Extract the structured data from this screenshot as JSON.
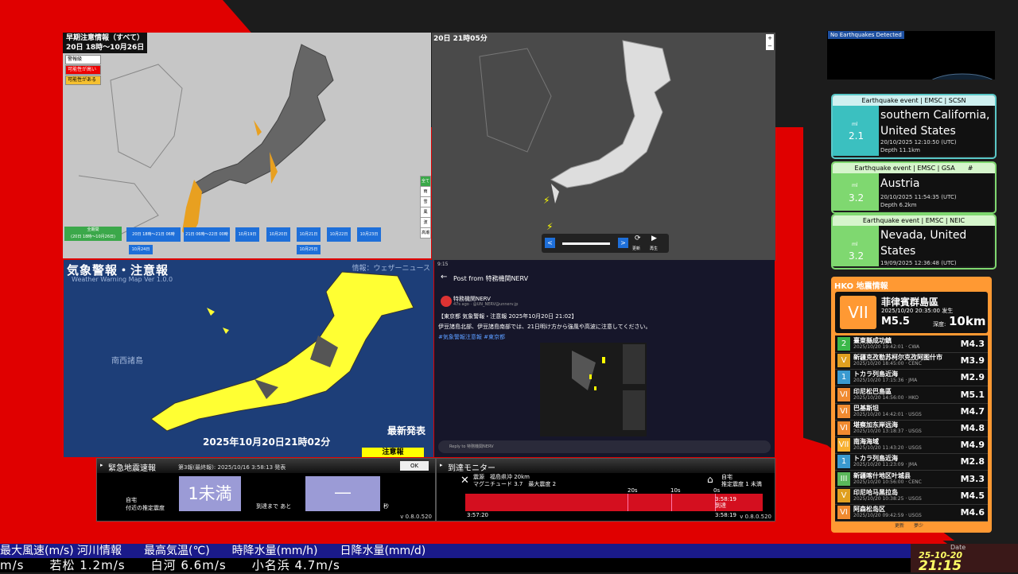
{
  "forecast": {
    "title": "早期注意情報（すべて）",
    "range": "20日 18時〜10月26日",
    "legend": [
      "警報級",
      "可能性が高い",
      "可能性がある"
    ],
    "buttons": [
      "全期間\n(20日 18時〜10月26日)",
      "20日 18時〜21日 06時",
      "21日 06時〜22日 00時",
      "10月19日",
      "10月20日",
      "10月21日",
      "10月22日",
      "10月23日",
      "10月24日",
      "10月25日"
    ],
    "side": [
      "全て",
      "雨",
      "雪",
      "風",
      "波",
      "高潮"
    ]
  },
  "map2": {
    "title": "20日 21時05分",
    "update": "更新",
    "play": "再生"
  },
  "warning": {
    "title": "気象警報・注意報",
    "subtitle": "Weather Warning Map Ver 1.0.0",
    "info": "情報：ウェザーニュース",
    "region": "南西諸島",
    "latest": "最新発表",
    "datetime": "2025年10月20日21時02分",
    "tag": "注意報"
  },
  "post": {
    "status_time": "9:15",
    "header": "Post from 特務機関NERV",
    "user": "特務機関NERV",
    "handle": "47s ago · @UN_NERV@unnerv.jp",
    "line1": "【東京都 気象警報・注意報 2025年10月20日 21:02】",
    "line2": "伊豆諸島北部、伊豆諸島南部では、21日明け方から強風や高波に注意してください。",
    "hashtags": "#気象警報注意報 #東京都",
    "reply": "Reply to 特務機関NERV"
  },
  "eew": {
    "title": "緊急地震速報",
    "sub": "第3報(最終報): 2025/10/16 3:58:13 発表",
    "ok": "OK",
    "home1": "自宅",
    "home2": "付近の推定震度",
    "intensity": "1未満",
    "until": "到達まで あと",
    "time": "―",
    "sec": "秒",
    "version": "v 0.8.0.520"
  },
  "arrival": {
    "title": "到達モニター",
    "epi1": "震源　福島県沖 20km",
    "epi2": "マグニチュード 3.7　最大震度 2",
    "home1": "自宅",
    "home2": "推定震度 1 未満",
    "ticks": [
      "20s",
      "10s",
      "0s"
    ],
    "arrive_time": "3:58:19",
    "arrived": "到達",
    "start": "3:57:20",
    "end": "3:58:19",
    "version": "v 0.8.0.520"
  },
  "globe": {
    "status": "No Earthquakes Detected"
  },
  "events": [
    {
      "header": "Earthquake event | EMSC | SCSN",
      "unit": "ml",
      "mag": "2.1",
      "place": "southern California, United States",
      "time": "20/10/2025 12:10:50 (UTC)",
      "depth": "Depth 11.1km",
      "color": "#3bc0c0"
    },
    {
      "header": "Earthquake event | EMSC | GSA",
      "extra": "#",
      "unit": "ml",
      "mag": "3.2",
      "place": "Austria",
      "time": "20/10/2025 11:54:35 (UTC)",
      "depth": "Depth 6.2km",
      "color": "#7fd870"
    },
    {
      "header": "Earthquake event | EMSC | NEIC",
      "unit": "ml",
      "mag": "3.2",
      "place": "Nevada, United States",
      "time": "19/09/2025 12:36:48 (UTC)",
      "depth": "",
      "color": "#7fd870"
    }
  ],
  "hko": {
    "title": "HKO 地震情報",
    "int": "VII",
    "loc": "菲律賓群島區",
    "time": "2025/10/20 20:35:00 发生",
    "mag": "M5.5",
    "depth_label": "深度:",
    "depth": "10km",
    "pager": "更新　　夢少",
    "list": [
      {
        "i": "2",
        "n": "臺東縣成功鎮",
        "d": "2025/10/20 19:42:01 · CWA",
        "m": "M4.3",
        "c": "#3bb84a"
      },
      {
        "i": "V",
        "n": "新疆克孜勒苏柯尔克孜阿图什市",
        "d": "2025/10/20 18:45:00 · CENC",
        "m": "M3.9",
        "c": "#e0a020"
      },
      {
        "i": "1",
        "n": "トカラ列島近海",
        "d": "2025/10/20 17:15:36 · JMA",
        "m": "M2.9",
        "c": "#3a9ad0"
      },
      {
        "i": "VI",
        "n": "印尼松巴島區",
        "d": "2025/10/20 14:56:00 · HKO",
        "m": "M5.1",
        "c": "#f08a30"
      },
      {
        "i": "VI",
        "n": "巴基斯坦",
        "d": "2025/10/20 14:42:01 · USGS",
        "m": "M4.7",
        "c": "#f08a30"
      },
      {
        "i": "VI",
        "n": "堪察加东岸远海",
        "d": "2025/10/20 13:18:37 · USGS",
        "m": "M4.8",
        "c": "#f08a30"
      },
      {
        "i": "VII",
        "n": "南海海域",
        "d": "2025/10/20 11:43:20 · USGS",
        "m": "M4.9",
        "c": "#f7b030"
      },
      {
        "i": "1",
        "n": "トカラ列島近海",
        "d": "2025/10/20 11:23:09 · JMA",
        "m": "M2.8",
        "c": "#3a9ad0"
      },
      {
        "i": "III",
        "n": "新疆喀什地区叶城县",
        "d": "2025/10/20 10:56:00 · CENC",
        "m": "M3.3",
        "c": "#5ab85a"
      },
      {
        "i": "V",
        "n": "印尼哈马黑拉岛",
        "d": "2025/10/20 10:38:25 · USGS",
        "m": "M4.5",
        "c": "#e0a020"
      },
      {
        "i": "VI",
        "n": "阿森松岛区",
        "d": "2025/10/20 09:42:59 · USGS",
        "m": "M4.6",
        "c": "#f08a30"
      }
    ]
  },
  "ticker": {
    "line1": "最大風速(m/s) 河川情報　　最高気温(℃)　　時降水量(mm/h)　　日降水量(mm/d)",
    "line2": "m/s　　若松 1.2m/s　　白河 6.6m/s　　小名浜 4.7m/s"
  },
  "clock": {
    "label": "Date",
    "date": "25-10-20",
    "time": "21:15"
  }
}
